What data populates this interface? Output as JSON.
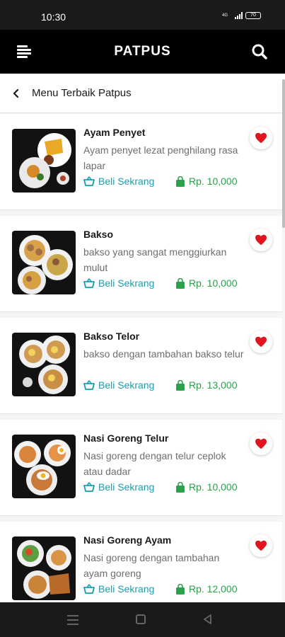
{
  "status": {
    "time": "10:30",
    "network": "4G",
    "battery": "70"
  },
  "app": {
    "title": "PATPUS"
  },
  "subheader": {
    "title": "Menu Terbaik Patpus"
  },
  "items": [
    {
      "name": "Ayam Penyet",
      "desc": "Ayam penyet lezat penghilang rasa lapar",
      "buy_label": "Beli Sekrang",
      "price": "Rp. 10,000"
    },
    {
      "name": "Bakso",
      "desc": "bakso yang sangat menggiurkan mulut",
      "buy_label": "Beli Sekrang",
      "price": "Rp. 10,000"
    },
    {
      "name": "Bakso Telor",
      "desc": "bakso dengan tambahan bakso telur",
      "buy_label": "Beli Sekrang",
      "price": "Rp. 13,000"
    },
    {
      "name": "Nasi Goreng Telur",
      "desc": "Nasi goreng dengan telur ceplok atau dadar",
      "buy_label": "Beli Sekrang",
      "price": "Rp. 10,000"
    },
    {
      "name": "Nasi Goreng Ayam",
      "desc": "Nasi goreng dengan tambahan ayam goreng",
      "buy_label": "Beli Sekrang",
      "price": "Rp. 12,000"
    }
  ],
  "colors": {
    "app_bar": "#000000",
    "buy": "#1b9fb0",
    "price": "#2ba14b",
    "favorite": "#e0161f"
  },
  "icons": {
    "menu": "menu-icon",
    "search": "search-icon",
    "back": "chevron-left-icon",
    "buy": "basket-icon",
    "price": "shopping-bag-icon",
    "favorite": "heart-icon"
  }
}
